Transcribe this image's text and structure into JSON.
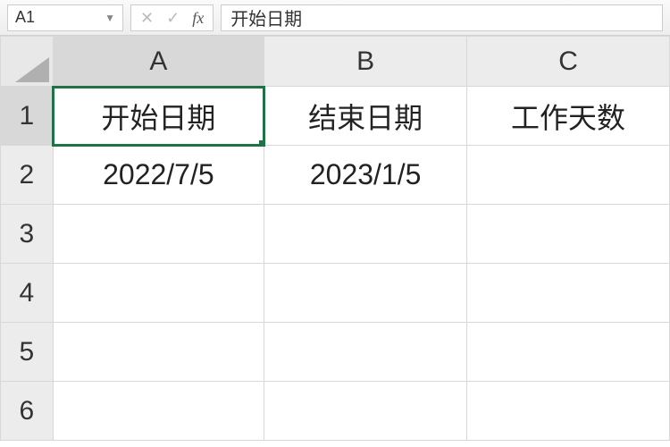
{
  "formula_bar": {
    "name_box": "A1",
    "formula_value": "开始日期"
  },
  "columns": {
    "A": "A",
    "B": "B",
    "C": "C"
  },
  "rows": {
    "r1": "1",
    "r2": "2",
    "r3": "3",
    "r4": "4",
    "r5": "5",
    "r6": "6"
  },
  "cells": {
    "A1": "开始日期",
    "B1": "结束日期",
    "C1": "工作天数",
    "A2": "2022/7/5",
    "B2": "2023/1/5",
    "C2": "",
    "A3": "",
    "B3": "",
    "C3": "",
    "A4": "",
    "B4": "",
    "C4": "",
    "A5": "",
    "B5": "",
    "C5": "",
    "A6": "",
    "B6": "",
    "C6": ""
  },
  "active_cell": "A1"
}
